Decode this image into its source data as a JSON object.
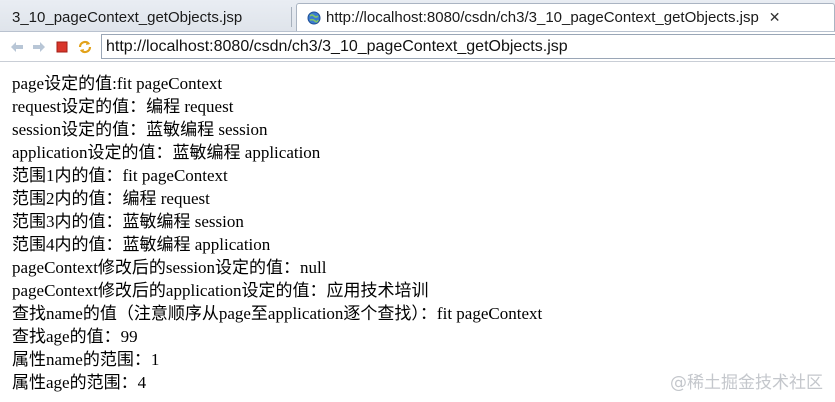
{
  "tabs": [
    {
      "label": "3_10_pageContext_getObjects.jsp",
      "active": false
    },
    {
      "label": "http://localhost:8080/csdn/ch3/3_10_pageContext_getObjects.jsp",
      "active": true
    }
  ],
  "toolbar": {
    "back_icon": "back-arrow-icon",
    "forward_icon": "forward-arrow-icon",
    "stop_icon": "stop-icon",
    "refresh_icon": "refresh-icon",
    "url": "http://localhost:8080/csdn/ch3/3_10_pageContext_getObjects.jsp"
  },
  "page": {
    "lines": [
      "page设定的值:fit pageContext",
      "request设定的值：编程 request",
      "session设定的值：蓝敏编程 session",
      "application设定的值：蓝敏编程 application",
      "范围1内的值：fit pageContext",
      "范围2内的值：编程 request",
      "范围3内的值：蓝敏编程 session",
      "范围4内的值：蓝敏编程 application",
      "pageContext修改后的session设定的值：null",
      "pageContext修改后的application设定的值：应用技术培训",
      "查找name的值（注意顺序从page至application逐个查找）：fit pageContext",
      "查找age的值：99",
      "属性name的范围：1",
      "属性age的范围：4"
    ]
  },
  "watermark": "@稀土掘金技术社区",
  "colors": {
    "stop": "#d9362b",
    "nav_arrows": "#b8c6d6",
    "refresh": "#e2a21a"
  }
}
